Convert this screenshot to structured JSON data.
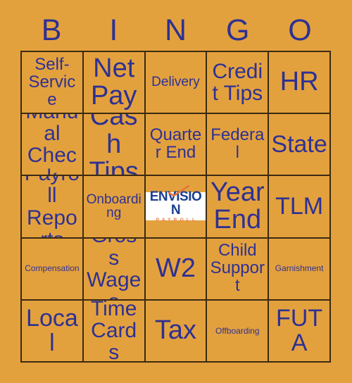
{
  "card": {
    "title": "BINGO",
    "background_color": "#e3a13e",
    "text_color": "#2e3192",
    "border_color": "#3b2a12"
  },
  "header": {
    "letters": [
      "B",
      "I",
      "N",
      "G",
      "O"
    ]
  },
  "grid": {
    "columns": 5,
    "rows": 5,
    "cells": [
      {
        "label": "Self-Service",
        "size": "m",
        "type": "term"
      },
      {
        "label": "Net Pay",
        "size": "xxl",
        "type": "term"
      },
      {
        "label": "Delivery",
        "size": "s",
        "type": "term"
      },
      {
        "label": "Credit Tips",
        "size": "l",
        "type": "term"
      },
      {
        "label": "HR",
        "size": "xxl",
        "type": "term"
      },
      {
        "label": "Manual Check",
        "size": "l",
        "type": "term"
      },
      {
        "label": "Cash Tips",
        "size": "xxl",
        "type": "term"
      },
      {
        "label": "Quarter End",
        "size": "m",
        "type": "term"
      },
      {
        "label": "Federal",
        "size": "m",
        "type": "term"
      },
      {
        "label": "State",
        "size": "xl",
        "type": "term"
      },
      {
        "label": "Payroll Reports",
        "size": "l",
        "type": "term"
      },
      {
        "label": "Onboarding",
        "size": "s",
        "type": "term"
      },
      {
        "label": "",
        "size": "m",
        "type": "logo"
      },
      {
        "label": "Year End",
        "size": "xxl",
        "type": "term"
      },
      {
        "label": "TLM",
        "size": "xl",
        "type": "term"
      },
      {
        "label": "Compensation",
        "size": "xs",
        "type": "term"
      },
      {
        "label": "Gross Wages",
        "size": "l",
        "type": "term"
      },
      {
        "label": "W2",
        "size": "xxl",
        "type": "term"
      },
      {
        "label": "Child Support",
        "size": "m",
        "type": "term"
      },
      {
        "label": "Garnishment",
        "size": "xs",
        "type": "term"
      },
      {
        "label": "Local",
        "size": "xl",
        "type": "term"
      },
      {
        "label": "Time Cards",
        "size": "l",
        "type": "term"
      },
      {
        "label": "Tax",
        "size": "xxl",
        "type": "term"
      },
      {
        "label": "Offboarding",
        "size": "xs",
        "type": "term"
      },
      {
        "label": "FUTA",
        "size": "xl",
        "type": "term"
      }
    ]
  },
  "logo": {
    "wordmark": "ENVISION",
    "subtext": "PAYROLL",
    "wordmark_color": "#1b3f8f",
    "subtext_color": "#e8743b",
    "check_color": "#e8743b",
    "background_color": "#ffffff"
  }
}
